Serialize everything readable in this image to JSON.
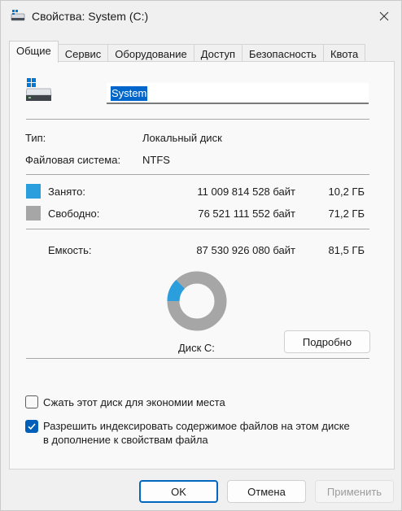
{
  "window": {
    "title": "Свойства: System (C:)"
  },
  "tabs": [
    {
      "label": "Общие",
      "active": true
    },
    {
      "label": "Сервис"
    },
    {
      "label": "Оборудование"
    },
    {
      "label": "Доступ"
    },
    {
      "label": "Безопасность"
    },
    {
      "label": "Квота"
    }
  ],
  "general": {
    "volume_name": "System",
    "type_label": "Тип:",
    "type_value": "Локальный диск",
    "fs_label": "Файловая система:",
    "fs_value": "NTFS",
    "used": {
      "label": "Занято:",
      "bytes": "11 009 814 528 байт",
      "size": "10,2 ГБ",
      "color": "#2b9ede"
    },
    "free": {
      "label": "Свободно:",
      "bytes": "76 521 111 552 байт",
      "size": "71,2 ГБ",
      "color": "#a6a6a6"
    },
    "capacity": {
      "label": "Емкость:",
      "bytes": "87 530 926 080 байт",
      "size": "81,5 ГБ"
    },
    "used_fraction": 0.1258,
    "disk_label": "Диск C:",
    "details_button": "Подробно",
    "compress_label": "Сжать этот диск для экономии места",
    "compress_checked": false,
    "index_label_line1": "Разрешить индексировать содержимое файлов на этом диске",
    "index_label_line2": "в дополнение к свойствам файла",
    "index_checked": true
  },
  "buttons": {
    "ok": "OK",
    "cancel": "Отмена",
    "apply": "Применить"
  },
  "icons": {
    "close": "close-icon",
    "drive": "drive-icon",
    "check": "checkmark-icon"
  }
}
